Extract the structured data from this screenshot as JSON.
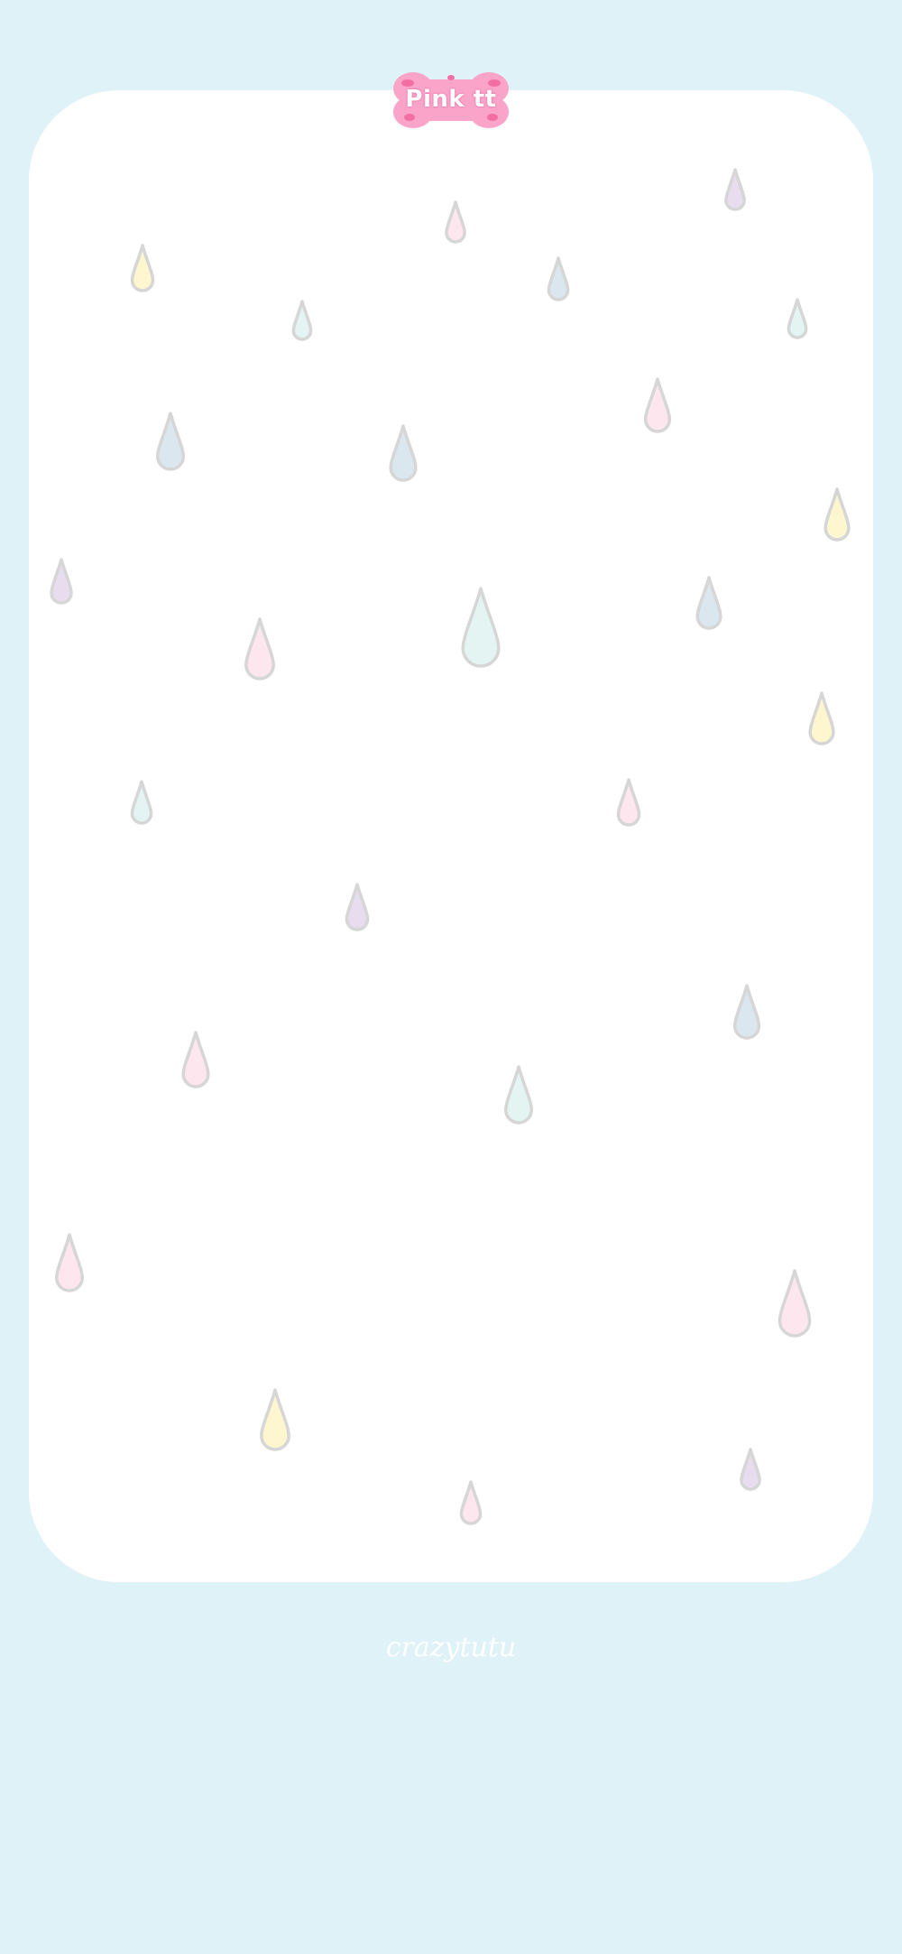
{
  "badge": {
    "label": "Pink tt",
    "fill_color": "#f9a4c8",
    "dot_color": "#f26fa6"
  },
  "watermark": {
    "text": "crazytutu"
  },
  "colors": {
    "background": "#dff2f8",
    "card": "#ffffff",
    "drop_outline": "#d6d6d6",
    "drop_fills": [
      "#fdf6cf",
      "#fde6ee",
      "#dbe7ee",
      "#e4f4f2",
      "#e7ddef"
    ]
  },
  "raindrop_icon": "raindrop-icon"
}
